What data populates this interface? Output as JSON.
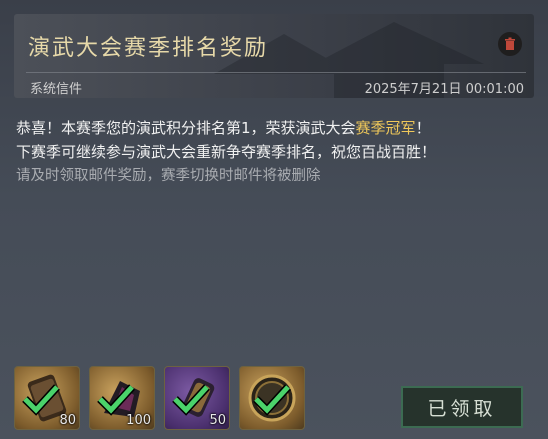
{
  "mail": {
    "title": "演武大会赛季排名奖励",
    "sender": "系统信件",
    "date": "2025年7月21日 00:01:00",
    "icons": {
      "delete": "trash-icon"
    }
  },
  "message": {
    "line1_a": "恭喜！本赛季您的演武积分排名第1，荣获演武大会",
    "line1_highlight": "赛季冠军",
    "line1_b": "！",
    "line2": "下赛季可继续参与演武大会重新争夺赛季排名，祝您百战百胜！",
    "line3": "请及时领取邮件奖励，赛季切换时邮件将被删除"
  },
  "rewards": [
    {
      "icon": "scroll-item-icon",
      "count": "80",
      "rarity": "gold",
      "claimed": true
    },
    {
      "icon": "dark-crystal-item-icon",
      "count": "100",
      "rarity": "gold",
      "claimed": true
    },
    {
      "icon": "gauntlet-item-icon",
      "count": "50",
      "rarity": "purple",
      "claimed": true
    },
    {
      "icon": "ring-frame-item-icon",
      "count": "",
      "rarity": "gold",
      "claimed": true
    }
  ],
  "claim_button": {
    "label": "已领取"
  },
  "colors": {
    "highlight": "#f0c85a",
    "title": "#e7d9a9",
    "check": "#4bd26a"
  }
}
